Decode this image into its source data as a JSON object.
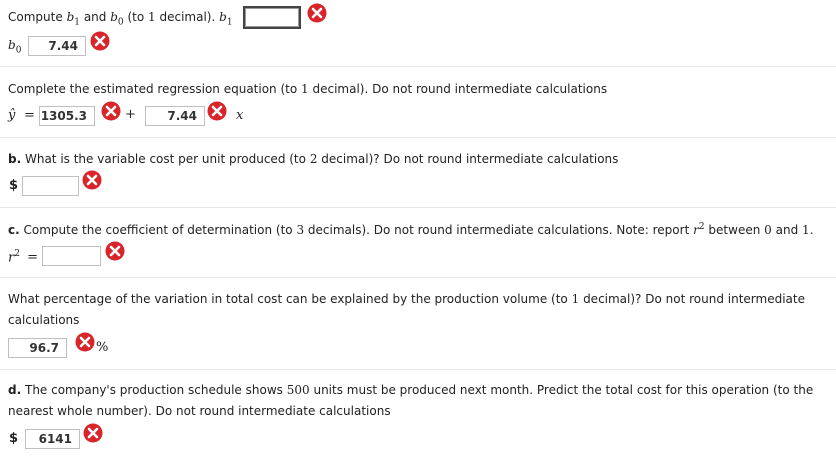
{
  "q_a": {
    "prompt_lead": "Compute",
    "b1": "b",
    "b1_sub": "1",
    "and": "and",
    "b0": "b",
    "b0_sub": "0",
    "prompt_tail": "(to",
    "digits": "1",
    "prompt_end": "decimal).",
    "b1_label": "b",
    "b1_label_sub": "1",
    "b1_value": "",
    "b0_label": "b",
    "b0_label_sub": "0",
    "b0_value": "7.44"
  },
  "q_eq": {
    "prompt": "Complete the estimated regression equation (to",
    "digits": "1",
    "prompt_tail": "decimal). Do not round intermediate calculations",
    "yhat": "ŷ",
    "equals": "=",
    "intercept_value": "1305.3",
    "plus": "+",
    "slope_value": "7.44",
    "xvar": "x"
  },
  "q_b": {
    "letter": "b.",
    "prompt": "What is the variable cost per unit produced (to",
    "digits": "2",
    "prompt_tail": "decimal)? Do not round intermediate calculations",
    "currency": "$",
    "value": ""
  },
  "q_c": {
    "letter": "c.",
    "prompt": "Compute the coefficient of determination (to",
    "digits": "3",
    "prompt_mid": "decimals). Do not round intermediate calculations. Note: report",
    "r": "r",
    "sup": "2",
    "between": "between",
    "low": "0",
    "and": "and",
    "high": "1.",
    "label_r": "r",
    "label_sup": "2",
    "equals": "=",
    "value": ""
  },
  "q_pct": {
    "line1": "What percentage of the variation in total cost can be explained by the production volume (to",
    "digits": "1",
    "line1_tail": "decimal)? Do not round intermediate",
    "line2": "calculations",
    "value": "96.7",
    "unit": "%"
  },
  "q_d": {
    "letter": "d.",
    "line1": "The company's production schedule shows",
    "units": "500",
    "line1_tail": "units must be produced next month. Predict the total cost for this operation (to the",
    "line2": "nearest whole number). Do not round intermediate calculations",
    "currency": "$",
    "value": "6141"
  },
  "colors": {
    "error_red": "#d9242a",
    "border": "#bfbfbf"
  },
  "icons": {
    "error": "red-x-circle-icon"
  }
}
